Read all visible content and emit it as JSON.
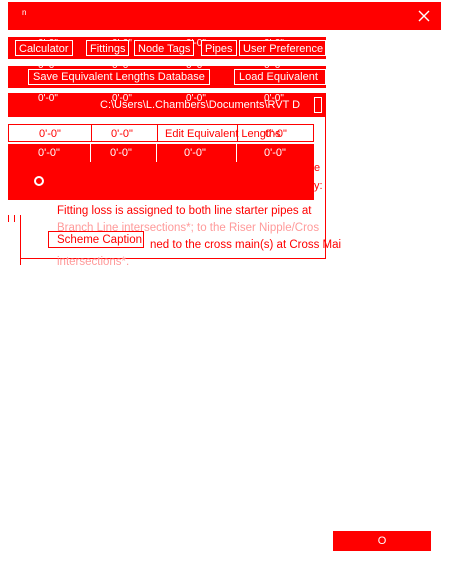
{
  "window": {
    "app_mark": "n"
  },
  "tabs": [
    "Calculator",
    "Fittings",
    "Node Tags",
    "Pipes",
    "User Preference"
  ],
  "toolbar": {
    "save_label": "Save Equivalent Lengths Database",
    "load_label": "Load Equivalent"
  },
  "path": {
    "value": "C:\\Users\\L.Chambers\\Documents\\RVT D"
  },
  "table": {
    "edit_label": "Edit Equivalent Lengths",
    "cell_value": "0'-0\"",
    "rows": [
      {
        "cells": [
          "0'-0\"",
          "0'-0\"",
          "0'-0\"",
          "0'-0\""
        ]
      },
      {
        "cells": [
          "0'-0\"",
          "0'-0\"",
          "0'-0\"",
          "0'-0\""
        ]
      }
    ]
  },
  "panel": {
    "edge_text_1": "e",
    "edge_text_2": "y:"
  },
  "description": {
    "line1": "Fitting loss is assigned to both line starter pipes at",
    "line2": "Branch Line intersections*; to the Riser Nipple/Cros",
    "line3": "Scheme Caption",
    "line3_rest": "ned to the cross main(s) at Cross Mai",
    "line4": "intersections*."
  },
  "footer": {
    "ok_label": "O"
  }
}
